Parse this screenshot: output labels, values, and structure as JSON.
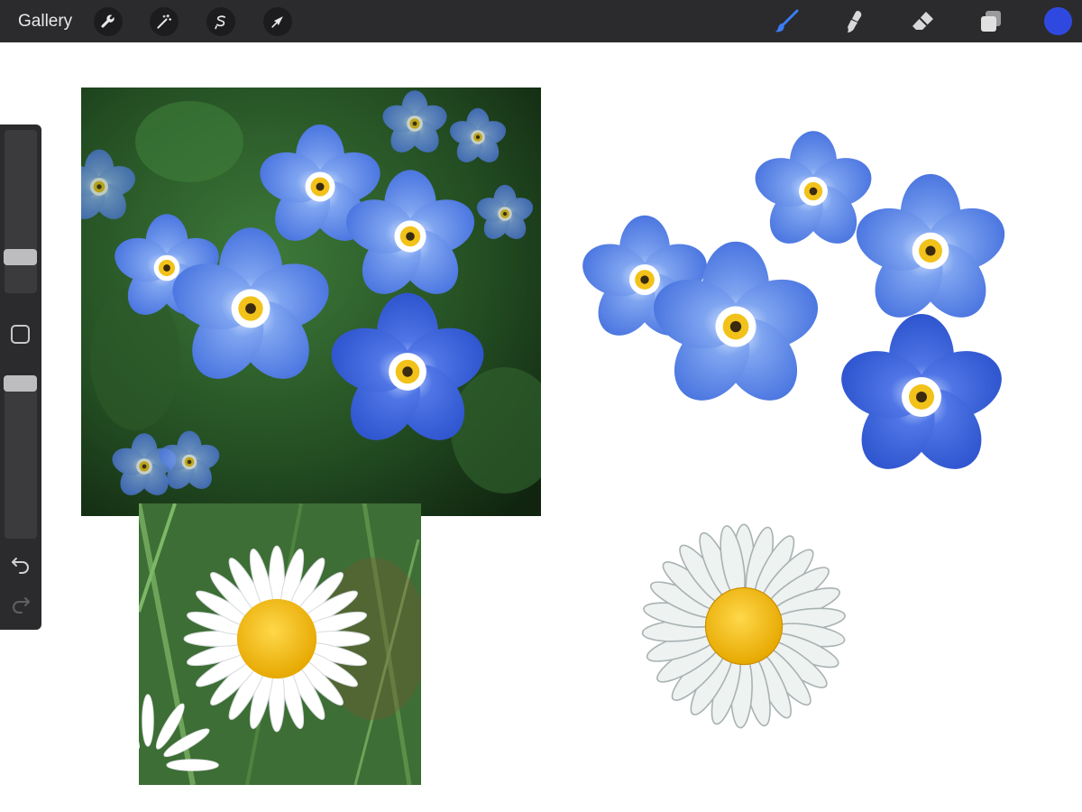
{
  "toolbar": {
    "gallery_label": "Gallery",
    "left_tools": [
      "wrench-icon",
      "magic-wand-icon",
      "selection-icon",
      "transform-arrow-icon"
    ],
    "right_tools": [
      "brush-icon",
      "smudge-icon",
      "eraser-icon",
      "layers-icon"
    ],
    "active_tool": "brush-icon",
    "current_color": "#2f49e0"
  },
  "sidebar": {
    "brush_size_level": 0.22,
    "opacity_level": 1.0
  },
  "canvas": {
    "background": "#ffffff",
    "images": [
      "forget-me-not-photo",
      "forget-me-not-painting",
      "daisy-photo",
      "daisy-painting"
    ]
  }
}
